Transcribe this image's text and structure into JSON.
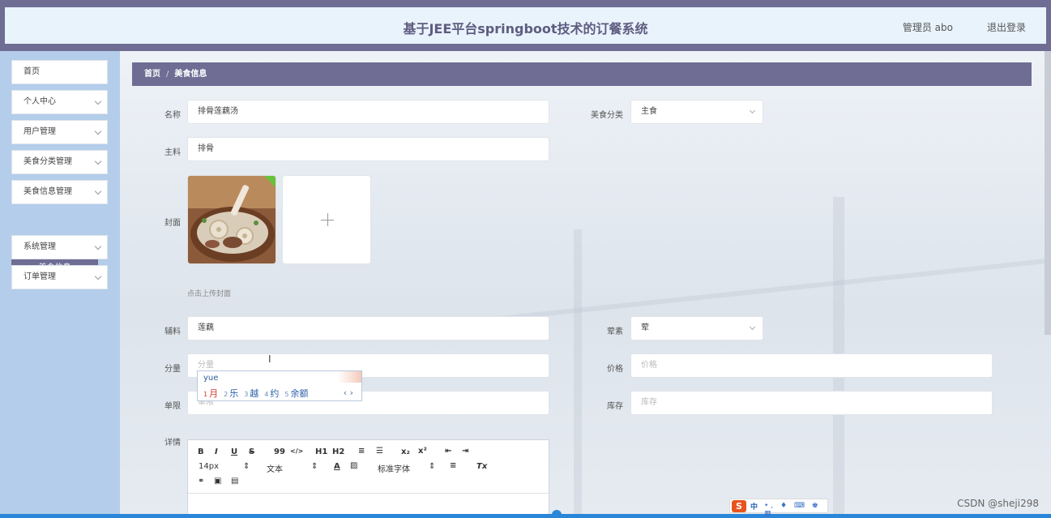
{
  "header": {
    "title": "基于JEE平台springboot技术的订餐系统",
    "user": "管理员 abo",
    "logout": "退出登录"
  },
  "sidebar": {
    "items": [
      {
        "label": "首页",
        "expandable": false
      },
      {
        "label": "个人中心",
        "expandable": true
      },
      {
        "label": "用户管理",
        "expandable": true
      },
      {
        "label": "美食分类管理",
        "expandable": true
      },
      {
        "label": "美食信息管理",
        "expandable": true
      },
      {
        "label": "系统管理",
        "expandable": true
      },
      {
        "label": "订单管理",
        "expandable": true
      }
    ],
    "active_sub": "美食信息"
  },
  "breadcrumb": {
    "home": "首页",
    "sep": "/",
    "current": "美食信息"
  },
  "form": {
    "name": {
      "label": "名称",
      "value": "排骨莲藕汤"
    },
    "category": {
      "label": "美食分类",
      "value": "主食"
    },
    "main_ingredient": {
      "label": "主料",
      "value": "排骨"
    },
    "cover": {
      "label": "封面",
      "hint": "点击上传封面"
    },
    "side_ingredient": {
      "label": "辅料",
      "value": "莲藕"
    },
    "meat_veg": {
      "label": "荤素",
      "value": "荤"
    },
    "portion": {
      "label": "分量",
      "placeholder": "分量"
    },
    "price": {
      "label": "价格",
      "placeholder": "价格"
    },
    "limit": {
      "label": "单限",
      "placeholder": "单限"
    },
    "stock": {
      "label": "库存",
      "placeholder": "库存"
    },
    "detail": {
      "label": "详情"
    }
  },
  "ime_popup": {
    "composition": "yue",
    "candidates": [
      {
        "n": "1",
        "text": "月"
      },
      {
        "n": "2",
        "text": "乐"
      },
      {
        "n": "3",
        "text": "越"
      },
      {
        "n": "4",
        "text": "约"
      },
      {
        "n": "5",
        "text": "余额"
      }
    ],
    "nav": "‹ ›"
  },
  "editor": {
    "row1": [
      "B",
      "I",
      "U",
      "S",
      "99",
      "</>",
      "H1",
      "H2",
      "≡",
      "☰",
      "x₂",
      "x²",
      "⇤",
      "⇥"
    ],
    "font_size": "14px",
    "text_type": "文本",
    "font_family": "标准字体",
    "clear": "Tx"
  },
  "taskbar": {
    "ime_logo": "S",
    "ime_mode": "中",
    "ime_icons": "•, ♦ ⌨ ♚ ▦"
  },
  "watermark": "CSDN @sheji298",
  "colors": {
    "accent": "#6f6d94",
    "sidebar_bg": "#b3cdea",
    "success": "#67c23a"
  }
}
